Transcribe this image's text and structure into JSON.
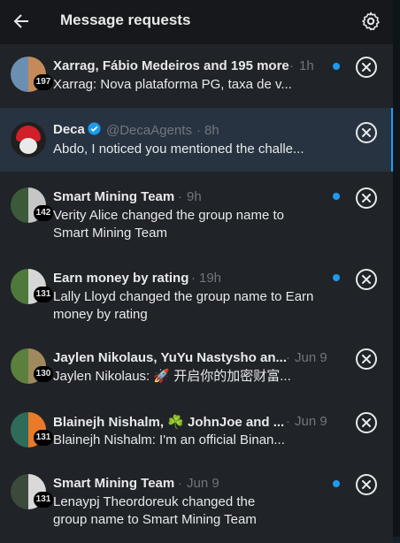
{
  "header": {
    "title": "Message requests"
  },
  "rows": [
    {
      "name": "Xarrag, Fábio Medeiros and 195 more",
      "time": "1h",
      "preview": "Xarrag: Nova plataforma PG, taxa de v...",
      "count": "197",
      "unread": true,
      "colors": [
        "#6b8fb3",
        "#c58a5a"
      ]
    },
    {
      "name": "Deca",
      "handle": "@DecaAgents",
      "time": "8h",
      "preview": "Abdo, I noticed you mentioned the challe...",
      "selected": true,
      "colors": [
        "#d21f2a",
        "#ffffff"
      ]
    },
    {
      "name": "Smart Mining Team",
      "time": "9h",
      "preview": "Verity Alice changed the group name to Smart Mining Team",
      "count": "142",
      "unread": true,
      "colors": [
        "#3b5a3a",
        "#c6c6c6"
      ]
    },
    {
      "name": "Earn money by rating",
      "time": "19h",
      "preview": "Lally Lloyd changed the group name to Earn money by rating",
      "count": "131",
      "unread": true,
      "colors": [
        "#4d7a3a",
        "#d6d6d6"
      ]
    },
    {
      "name": "Jaylen Nikolaus, YuYu Nastysho an...",
      "time": "Jun 9",
      "preview": "Jaylen Nikolaus: 🚀 开启你的加密财富...",
      "count": "130",
      "unread": true,
      "colors": [
        "#5b7f3c",
        "#9e8a5e"
      ]
    },
    {
      "name": "Blainejh Nishalm, ☘️ JohnJoe and ...",
      "time": "Jun 9",
      "preview": "Blainejh Nishalm: I'm an official Binan...",
      "count": "131",
      "unread": true,
      "colors": [
        "#2f6b5a",
        "#e87a2a"
      ]
    },
    {
      "name": "Smart Mining Team",
      "time": "Jun 9",
      "preview": "Lenaypj Theordoreuk changed the group name to Smart Mining Team",
      "count": "131",
      "unread": true,
      "colors": [
        "#3b4a3a",
        "#d9d9d9"
      ]
    }
  ]
}
